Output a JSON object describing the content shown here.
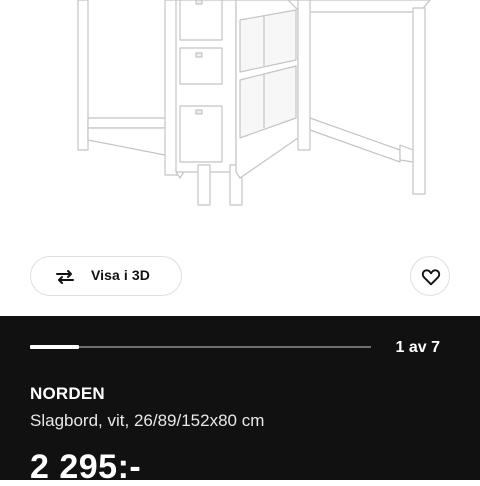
{
  "product_image": {
    "alt_icon": "norden-gateleg-table-illustration"
  },
  "view_3d_button": {
    "label": "Visa i 3D",
    "icon": "rotate-3d-icon"
  },
  "favorite_button": {
    "icon": "heart-icon"
  },
  "carousel": {
    "counter": "1 av 7",
    "current": 1,
    "total": 7
  },
  "product": {
    "name": "NORDEN",
    "description": "Slagbord, vit, 26/89/152x80 cm",
    "price": "2 295:-"
  },
  "colors": {
    "panel_background": "#111111",
    "page_background": "#ffffff",
    "furniture_white": "#ffffff",
    "furniture_outline": "#c9c9c9"
  }
}
